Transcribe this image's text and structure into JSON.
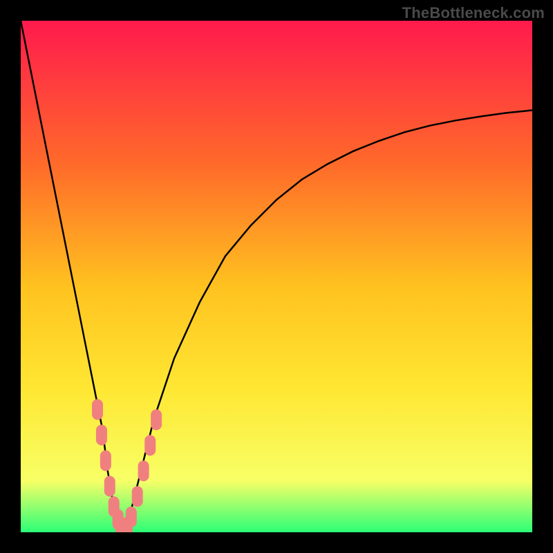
{
  "watermark": "TheBottleneck.com",
  "colors": {
    "frame": "#000000",
    "gradient_top": "#ff1a4d",
    "gradient_mid1": "#ff6a2a",
    "gradient_mid2": "#ffc21f",
    "gradient_mid3": "#ffe733",
    "gradient_mid4": "#f7ff66",
    "gradient_bottom": "#2bff77",
    "curve": "#000000",
    "marker": "#f08080"
  },
  "chart_data": {
    "type": "line",
    "title": "",
    "xlabel": "",
    "ylabel": "",
    "xlim": [
      0,
      100
    ],
    "ylim": [
      0,
      100
    ],
    "series": [
      {
        "name": "bottleneck-curve",
        "x": [
          0,
          2,
          4,
          6,
          8,
          10,
          12,
          14,
          16,
          17,
          18,
          19,
          20,
          21,
          22,
          24,
          26,
          30,
          35,
          40,
          45,
          50,
          55,
          60,
          65,
          70,
          75,
          80,
          85,
          90,
          95,
          100
        ],
        "y": [
          100,
          90,
          80,
          70,
          60,
          50,
          40,
          30,
          20,
          12,
          6,
          2,
          0,
          2,
          6,
          14,
          22,
          34,
          45,
          54,
          60,
          65,
          69,
          72,
          74.5,
          76.5,
          78.2,
          79.5,
          80.5,
          81.3,
          82,
          82.5
        ]
      }
    ],
    "minimum_x": 20,
    "markers": [
      {
        "x": 15.0,
        "y": 24
      },
      {
        "x": 15.8,
        "y": 19
      },
      {
        "x": 16.6,
        "y": 14
      },
      {
        "x": 17.4,
        "y": 9
      },
      {
        "x": 18.2,
        "y": 5
      },
      {
        "x": 19.0,
        "y": 2.5
      },
      {
        "x": 19.6,
        "y": 1
      },
      {
        "x": 20.2,
        "y": 0.5
      },
      {
        "x": 20.8,
        "y": 1
      },
      {
        "x": 21.6,
        "y": 3
      },
      {
        "x": 22.8,
        "y": 7
      },
      {
        "x": 24.0,
        "y": 12
      },
      {
        "x": 25.3,
        "y": 17
      },
      {
        "x": 26.5,
        "y": 22
      }
    ]
  }
}
